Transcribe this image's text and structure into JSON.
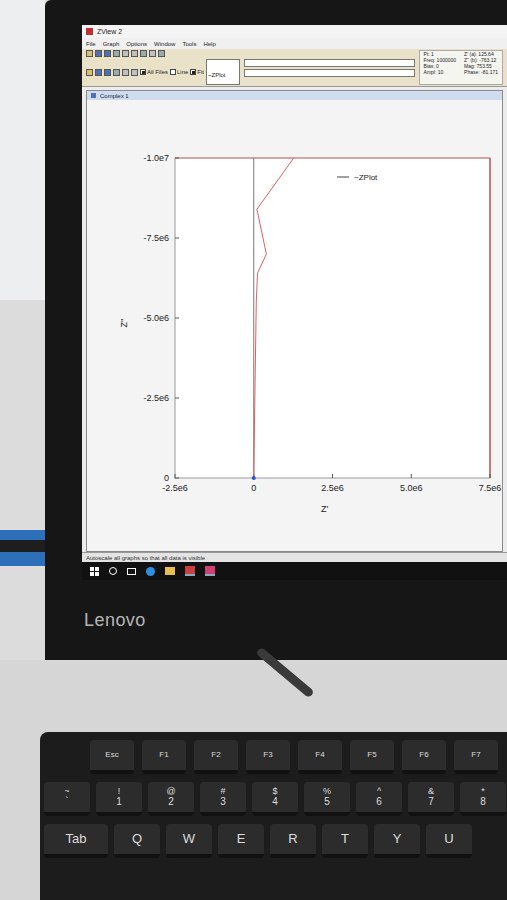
{
  "window": {
    "title": "ZView 2"
  },
  "menu": [
    "File",
    "Graph",
    "Options",
    "Window",
    "Tools",
    "Help"
  ],
  "toolbar": {
    "checks": [
      {
        "label": "All Files",
        "checked": true
      },
      {
        "label": "Line",
        "checked": false
      },
      {
        "label": "Fit",
        "checked": true
      }
    ],
    "plot_select": "~ZPlot"
  },
  "readout": {
    "left": [
      "Pt: 1",
      "Freq: 1000000",
      "Bias: 0",
      "Ampl: 10"
    ],
    "right": [
      "Z' (a): 125.64",
      "Z'' (b): -763.12",
      "Mag: 753.55",
      "Phase: -81.171"
    ]
  },
  "graph_window": {
    "title": "Complex 1"
  },
  "chart": {
    "x_label": "Z'",
    "y_label": "Z''",
    "x_ticks": [
      {
        "label": "-2.5e6",
        "value": -2500000
      },
      {
        "label": "0",
        "value": 0
      },
      {
        "label": "2.5e6",
        "value": 2500000
      },
      {
        "label": "5.0e6",
        "value": 5000000
      },
      {
        "label": "7.5e6",
        "value": 7500000
      }
    ],
    "y_ticks": [
      {
        "label": "-1.0e7",
        "value": -10000000
      },
      {
        "label": "-7.5e6",
        "value": -7500000
      },
      {
        "label": "-5.0e6",
        "value": -5000000
      },
      {
        "label": "-2.5e6",
        "value": -2500000
      },
      {
        "label": "0",
        "value": 0
      }
    ],
    "series": [
      {
        "name": "~ZPlot",
        "color": "#e06060",
        "z_real": [
          0,
          20000,
          50000,
          80000,
          120000,
          400000,
          100000,
          1270000
        ],
        "z_imag": [
          0,
          -1500000,
          -3500000,
          -5500000,
          -6400000,
          -7000000,
          -8400000,
          -10000000
        ]
      }
    ]
  },
  "status_bar": "Autoscale all graphs so that all data is visible",
  "monitor": {
    "brand": "Lenovo"
  },
  "keyboard": {
    "function_row": [
      "Esc",
      "F1",
      "F2",
      "F3",
      "F4",
      "F5",
      "F6",
      "F7"
    ],
    "number_row": [
      {
        "top": "~",
        "bottom": "`"
      },
      {
        "top": "!",
        "bottom": "1"
      },
      {
        "top": "@",
        "bottom": "2"
      },
      {
        "top": "#",
        "bottom": "3"
      },
      {
        "top": "$",
        "bottom": "4"
      },
      {
        "top": "%",
        "bottom": "5"
      },
      {
        "top": "^",
        "bottom": "6"
      },
      {
        "top": "&",
        "bottom": "7"
      },
      {
        "top": "*",
        "bottom": "8"
      }
    ],
    "letter_row": [
      "Tab",
      "Q",
      "W",
      "E",
      "R",
      "T",
      "Y",
      "U"
    ]
  }
}
